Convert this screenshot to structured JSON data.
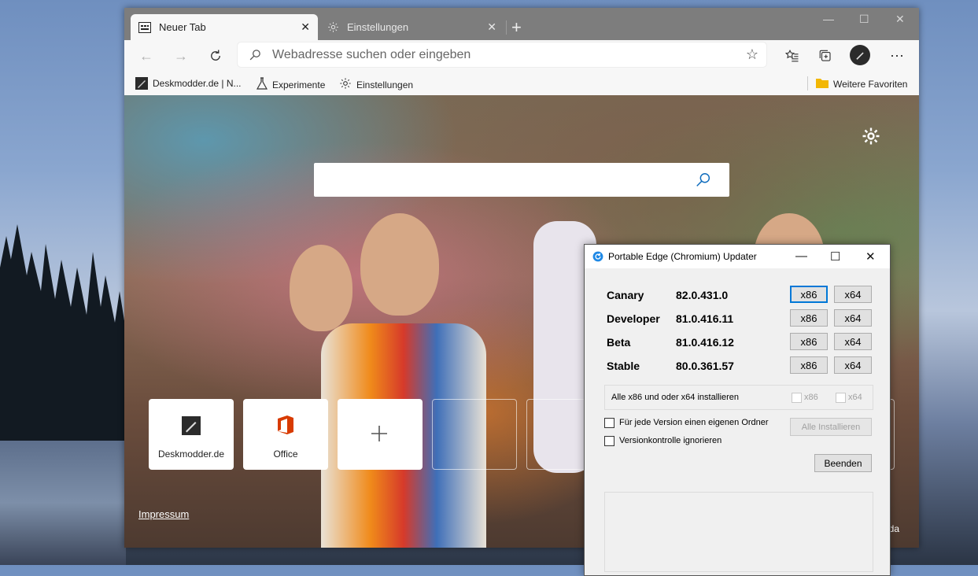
{
  "browser": {
    "tabs": [
      {
        "label": "Neuer Tab",
        "icon": "newtab-page-icon",
        "active": true
      },
      {
        "label": "Einstellungen",
        "icon": "gear-icon",
        "active": false
      }
    ],
    "new_tab_symbol": "+",
    "window_controls": {
      "minimize": "—",
      "maximize": "☐",
      "close": "✕"
    },
    "address_placeholder": "Webadresse suchen oder eingeben",
    "favorites_bar": [
      {
        "label": "Deskmodder.de | N...",
        "icon": "deskmodder-icon"
      },
      {
        "label": "Experimente",
        "icon": "flask-icon"
      },
      {
        "label": "Einstellungen",
        "icon": "gear-icon"
      }
    ],
    "other_favorites": "Weitere Favoriten"
  },
  "newtab": {
    "tiles": [
      {
        "label": "Deskmodder.de"
      },
      {
        "label": "Office"
      },
      {
        "label": ""
      }
    ],
    "impressum": "Impressum",
    "credit_partial": "nda"
  },
  "updater": {
    "title": "Portable Edge (Chromium) Updater",
    "rows": [
      {
        "channel": "Canary",
        "version": "82.0.431.0"
      },
      {
        "channel": "Developer",
        "version": "81.0.416.11"
      },
      {
        "channel": "Beta",
        "version": "81.0.416.12"
      },
      {
        "channel": "Stable",
        "version": "80.0.361.57"
      }
    ],
    "x86_label": "x86",
    "x64_label": "x64",
    "install_all_text": "Alle x86 und oder x64 installieren",
    "own_folder_label": "Für jede Version einen eigenen Ordner",
    "ignore_version_label": "Versionkontrolle ignorieren",
    "install_all_button": "Alle Installieren",
    "exit_button": "Beenden"
  },
  "colors": {
    "accent": "#0078d7",
    "tabstrip": "#7d7d7d",
    "office_red": "#d83b01"
  }
}
